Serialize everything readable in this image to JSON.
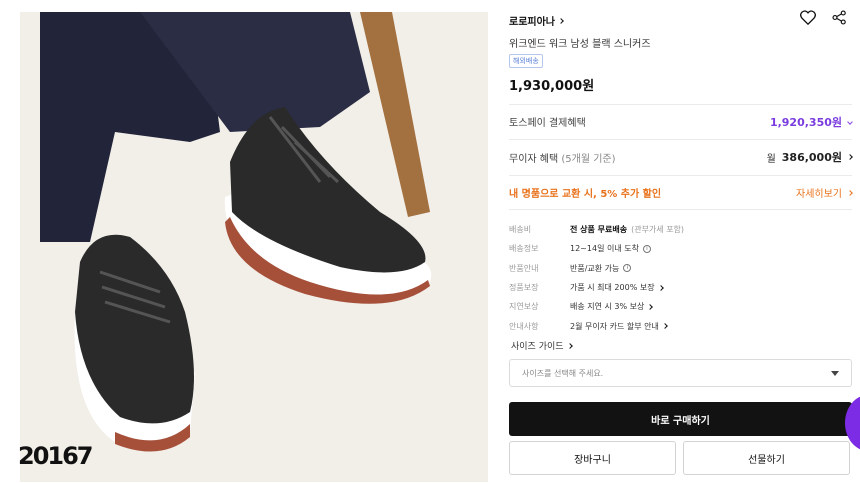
{
  "product": {
    "brand": "로로피아나",
    "name": "위크엔드 워크 남성 블랙 스니커즈",
    "tag": "해외배송",
    "price": "1,930,000원",
    "image_code": "20167"
  },
  "benefits": {
    "toss_label": "토스페이 결제혜택",
    "toss_value": "1,920,350원",
    "interest_label": "무이자 혜택",
    "interest_sub": "(5개월 기준)",
    "interest_prefix": "월",
    "interest_value": "386,000원",
    "trade_label": "내 명품으로 교환 시, 5% 추가 할인",
    "trade_more": "자세히보기"
  },
  "details": [
    {
      "key": "배송비",
      "value": "전 상품 무료배송",
      "note": "(관부가세 포함)"
    },
    {
      "key": "배송정보",
      "value": "12~14일 이내 도착"
    },
    {
      "key": "반품안내",
      "value": "반품/교환 가능"
    },
    {
      "key": "정품보장",
      "value": "가품 시 최대 200% 보장"
    },
    {
      "key": "지연보상",
      "value": "배송 지연 시 3% 보상"
    },
    {
      "key": "안내사항",
      "value": "2월 무이자 카드 할부 안내"
    }
  ],
  "size": {
    "guide_label": "사이즈 가이드",
    "placeholder": "사이즈를 선택해 주세요."
  },
  "actions": {
    "buy": "바로 구매하기",
    "cart": "장바구니",
    "gift": "선물하기"
  },
  "colors": {
    "accent_purple": "#7a3cde",
    "accent_orange": "#e8721c",
    "buy_button": "#121212"
  },
  "icons": [
    "heart-icon",
    "share-icon",
    "info-icon",
    "chevron-right-icon",
    "caret-down-icon"
  ]
}
